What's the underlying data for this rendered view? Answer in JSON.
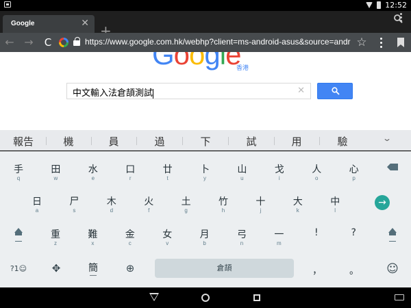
{
  "status_bar": {
    "time": "12:52"
  },
  "tab": {
    "title": "Google",
    "close": "✕",
    "new_tab": "+"
  },
  "toolbar": {
    "back": "←",
    "forward": "→",
    "reload": "C",
    "url": "https://www.google.com.hk/webhp?client=ms-android-asus&source=android-home&",
    "star": "☆"
  },
  "page": {
    "logo_letters": [
      {
        "ch": "G",
        "color": "#4285f4"
      },
      {
        "ch": "o",
        "color": "#ea4335"
      },
      {
        "ch": "o",
        "color": "#fbbc05"
      },
      {
        "ch": "g",
        "color": "#4285f4"
      },
      {
        "ch": "l",
        "color": "#34a853"
      },
      {
        "ch": "e",
        "color": "#ea4335"
      }
    ],
    "logo_sub": "香港",
    "search_value": "中文輸入法倉頡測試",
    "clear": "✕"
  },
  "suggestions": [
    "報告",
    "機",
    "員",
    "過",
    "下",
    "試",
    "用",
    "驗"
  ],
  "suggest_more": "⌄",
  "keyboard": {
    "row1": [
      {
        "main": "手",
        "sub": "q"
      },
      {
        "main": "田",
        "sub": "w"
      },
      {
        "main": "水",
        "sub": "e"
      },
      {
        "main": "口",
        "sub": "r"
      },
      {
        "main": "廿",
        "sub": "t"
      },
      {
        "main": "卜",
        "sub": "y"
      },
      {
        "main": "山",
        "sub": "u"
      },
      {
        "main": "戈",
        "sub": "i"
      },
      {
        "main": "人",
        "sub": "o"
      },
      {
        "main": "心",
        "sub": "p"
      }
    ],
    "row2": [
      {
        "main": "日",
        "sub": "a"
      },
      {
        "main": "尸",
        "sub": "s"
      },
      {
        "main": "木",
        "sub": "d"
      },
      {
        "main": "火",
        "sub": "f"
      },
      {
        "main": "土",
        "sub": "g"
      },
      {
        "main": "竹",
        "sub": "h"
      },
      {
        "main": "十",
        "sub": "j"
      },
      {
        "main": "大",
        "sub": "k"
      },
      {
        "main": "中",
        "sub": "l"
      }
    ],
    "row3": [
      {
        "main": "重",
        "sub": "z"
      },
      {
        "main": "難",
        "sub": "x"
      },
      {
        "main": "金",
        "sub": "c"
      },
      {
        "main": "女",
        "sub": "v"
      },
      {
        "main": "月",
        "sub": "b"
      },
      {
        "main": "弓",
        "sub": "n"
      },
      {
        "main": "一",
        "sub": "m"
      },
      {
        "main": "!",
        "sub": ""
      },
      {
        "main": "?",
        "sub": ""
      }
    ],
    "symbols_key": "?1☺",
    "nav_key": "✥",
    "lang_key": "簡",
    "lang_sub": "—",
    "globe_key": "⊕",
    "space_label": "倉頡",
    "comma_key": "，",
    "period_key": "。",
    "emoji_key": "☺",
    "enter_key": "→",
    "shift_sub": "—"
  }
}
